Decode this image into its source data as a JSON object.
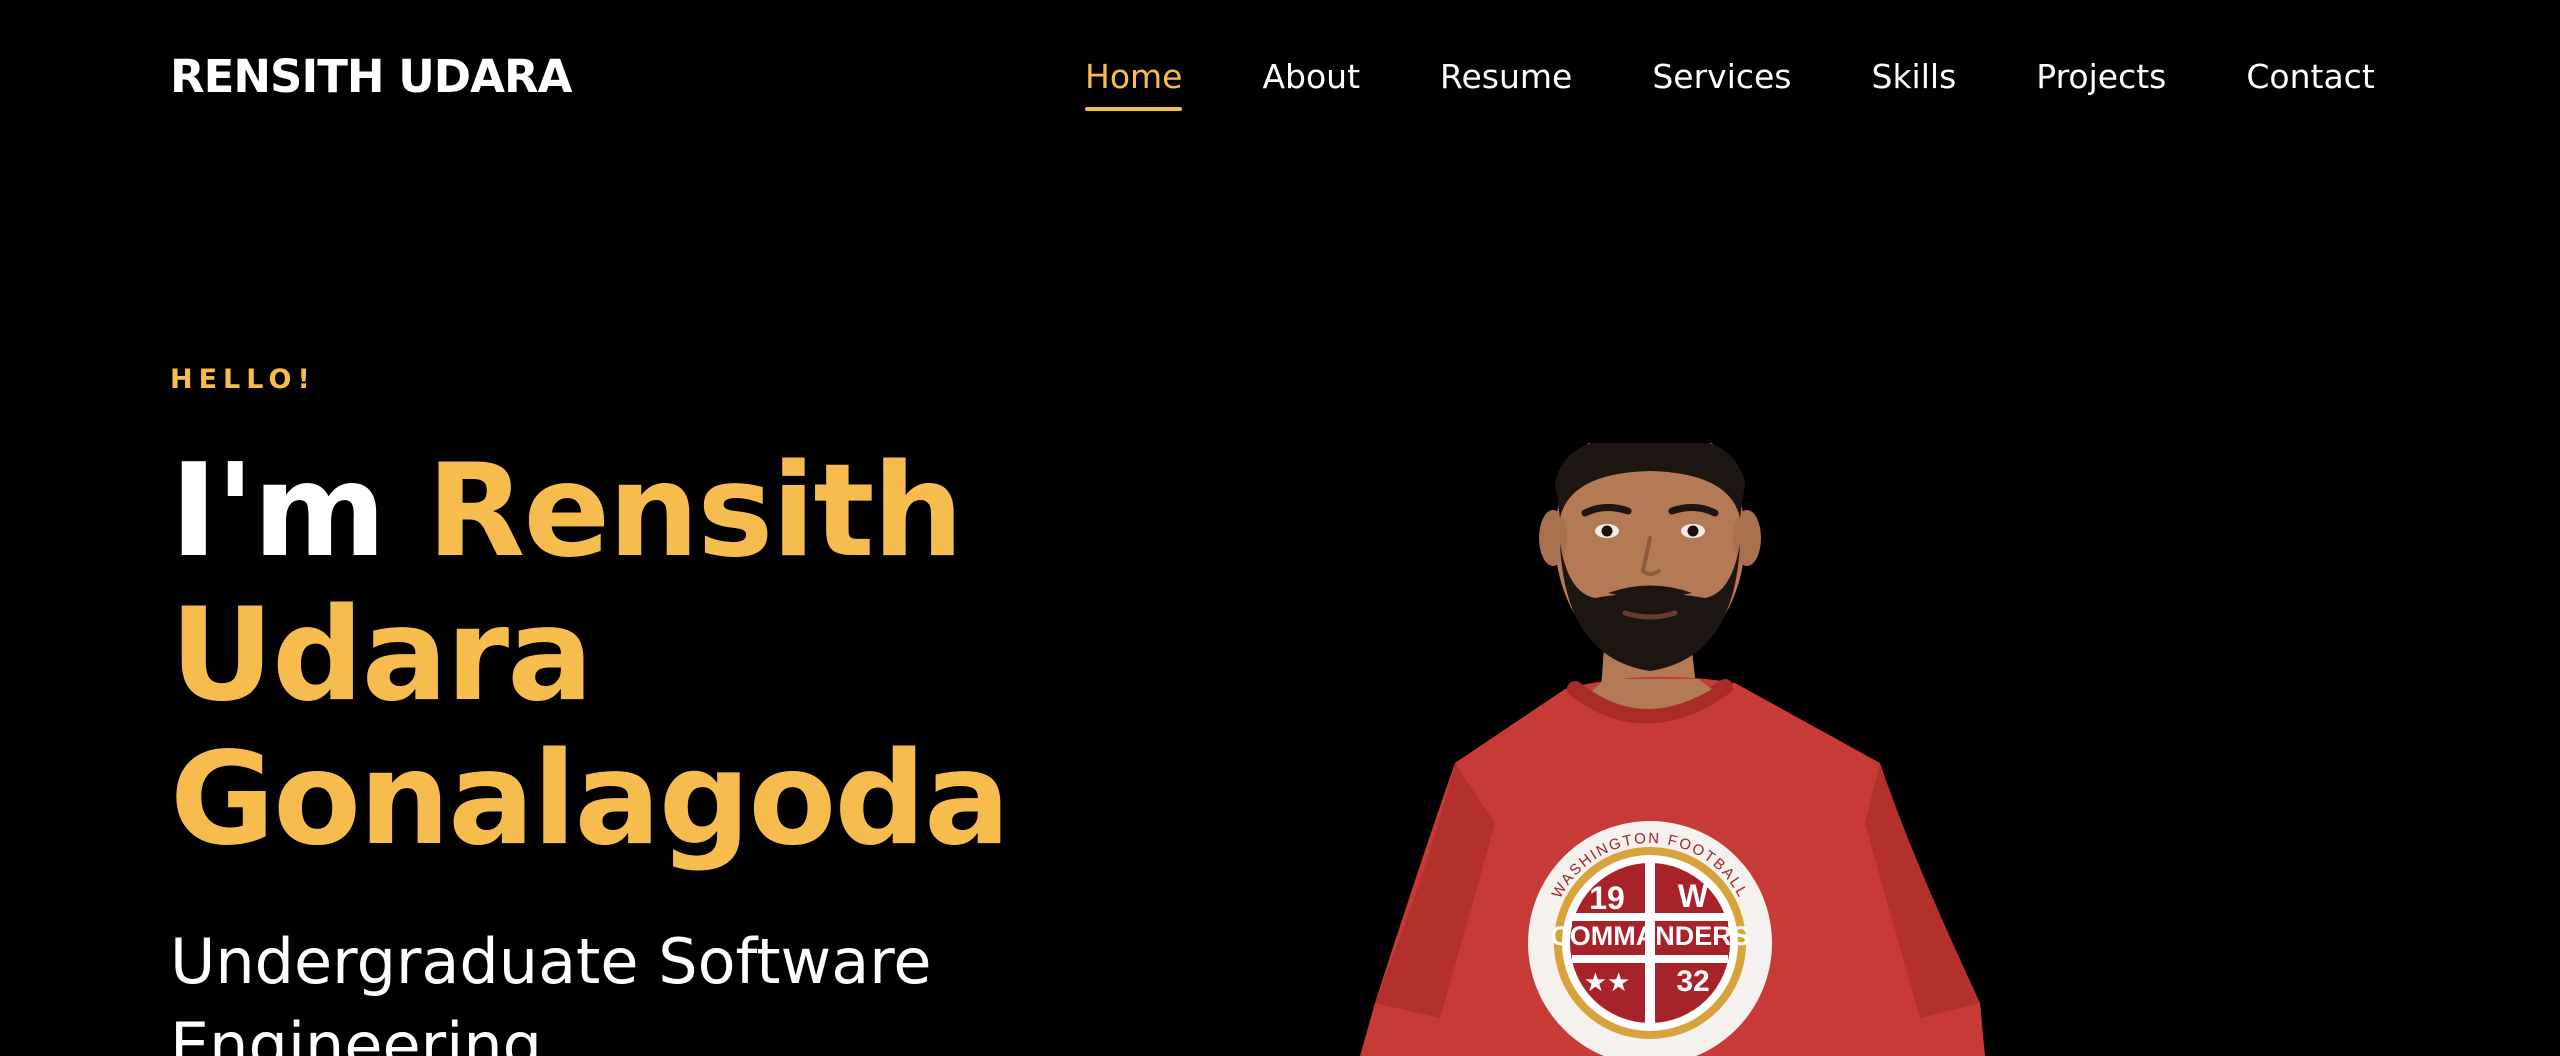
{
  "brand": {
    "name": "RENSITH UDARA"
  },
  "nav": {
    "items": [
      {
        "label": "Home",
        "active": true
      },
      {
        "label": "About",
        "active": false
      },
      {
        "label": "Resume",
        "active": false
      },
      {
        "label": "Services",
        "active": false
      },
      {
        "label": "Skills",
        "active": false
      },
      {
        "label": "Projects",
        "active": false
      },
      {
        "label": "Contact",
        "active": false
      }
    ]
  },
  "hero": {
    "greeting": "HELLO!",
    "intro": "I'm",
    "name_line1": "Rensith",
    "name_line2": "Udara",
    "name_line3": "Gonalagoda",
    "subtitle_line1": "Undergraduate Software",
    "subtitle_line2": "Engineering"
  },
  "portrait": {
    "shirt_badge": {
      "arc_text": "WASHINGTON FOOTBALL",
      "team": "COMMANDERS",
      "number_left": "19",
      "number_right": "32",
      "letter": "W"
    }
  },
  "colors": {
    "background": "#000000",
    "accent": "#f6bd4e",
    "text": "#ffffff",
    "shirt": "#c73a36"
  }
}
